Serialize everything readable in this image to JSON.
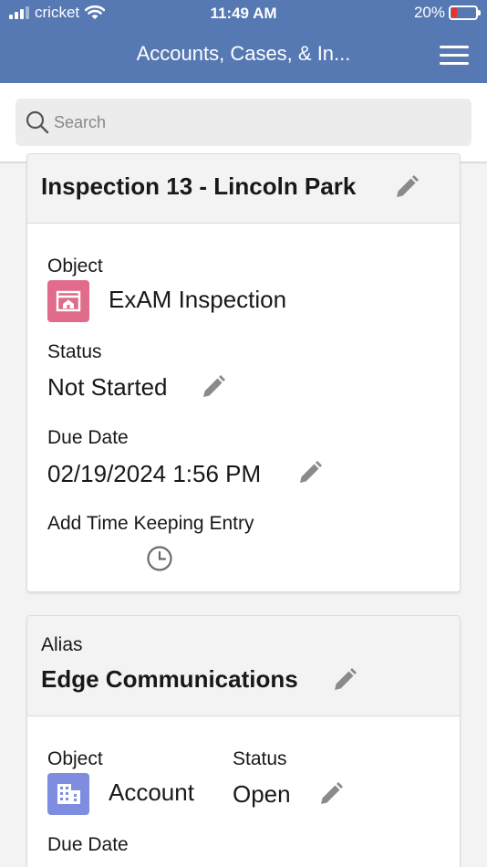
{
  "status_bar": {
    "carrier": "cricket",
    "time": "11:49 AM",
    "battery": "20%",
    "battery_level": 0.2
  },
  "nav": {
    "title": "Accounts, Cases, & In..."
  },
  "search": {
    "placeholder": "Search",
    "value": ""
  },
  "card1": {
    "title": "Inspection 13 - Lincoln Park",
    "object_label": "Object",
    "object_value": "ExAM Inspection",
    "status_label": "Status",
    "status_value": "Not Started",
    "due_label": "Due Date",
    "due_value": "02/19/2024 1:56 PM",
    "time_label": "Add Time Keeping Entry"
  },
  "card2": {
    "header_label": "Alias",
    "title": "Edge Communications",
    "object_label": "Object",
    "object_value": "Account",
    "status_label": "Status",
    "status_value": "Open",
    "due_label": "Due Date"
  },
  "colors": {
    "nav_bg": "#5678b3",
    "inspection_icon": "#e06b8b",
    "account_icon": "#7f8de1",
    "battery_low": "#e8322a"
  },
  "icons": [
    "signal-icon",
    "wifi-icon",
    "battery-icon",
    "menu-icon",
    "search-icon",
    "edit-icon",
    "inspection-object-icon",
    "account-object-icon",
    "clock-icon"
  ]
}
